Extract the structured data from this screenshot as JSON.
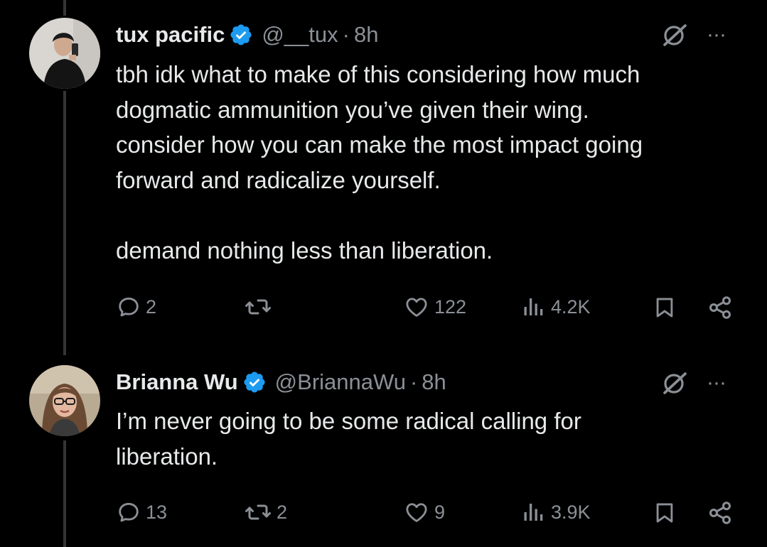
{
  "tweets": [
    {
      "display_name": "tux pacific",
      "handle": "@__tux",
      "separator": "·",
      "time": "8h",
      "text": "tbh idk what to make of this considering how much\ndogmatic ammunition you’ve given their wing.\nconsider how you can make the most impact going\nforward and radicalize yourself.\n\ndemand nothing less than liberation.",
      "replies": "2",
      "retweets": "",
      "likes": "122",
      "views": "4.2K",
      "more_label": "···"
    },
    {
      "display_name": "Brianna Wu",
      "handle": "@BriannaWu",
      "separator": "·",
      "time": "8h",
      "text": "I’m never going to be some radical calling for\nliberation.",
      "replies": "13",
      "retweets": "2",
      "likes": "9",
      "views": "3.9K",
      "more_label": "···"
    }
  ],
  "colors": {
    "background": "#000000",
    "text": "#e7e9ea",
    "muted": "#8b9096",
    "verified": "#1d9bf0",
    "thread_line": "#333639"
  },
  "icons": [
    "reply-icon",
    "retweet-icon",
    "like-icon",
    "views-icon",
    "bookmark-icon",
    "share-icon",
    "verified-badge-icon",
    "grok-icon",
    "more-icon"
  ]
}
